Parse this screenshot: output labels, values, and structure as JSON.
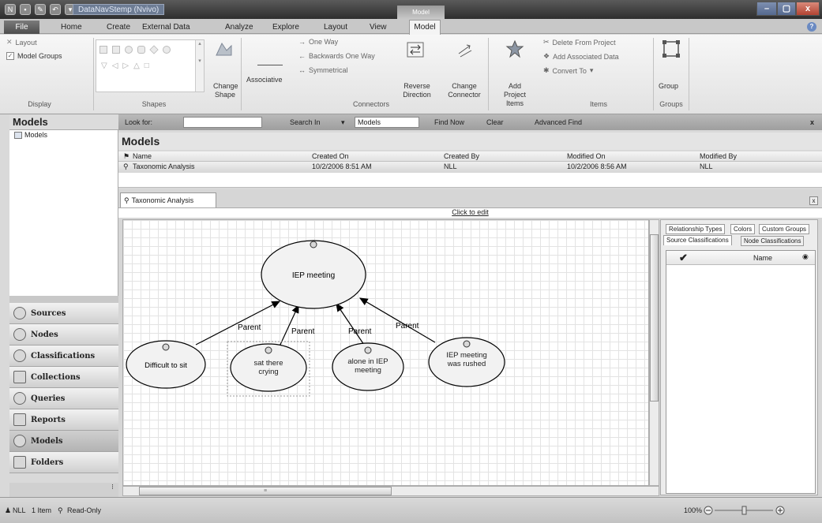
{
  "window": {
    "title": "DataNavStemp (Nvivo)",
    "context_tab_caption": "Model",
    "controls": [
      "–",
      "▢",
      "x"
    ]
  },
  "ribbon_tabs": [
    "File",
    "Home",
    "Create",
    "External Data",
    "Analyze",
    "Explore",
    "Layout",
    "View",
    "Model"
  ],
  "ribbon": {
    "display": {
      "layout": "Layout",
      "model_groups": "Model Groups",
      "group_label": "Display"
    },
    "shapes": {
      "change_shape": "Change Shape",
      "group_label": "Shapes"
    },
    "connectors": {
      "associative": "Associative",
      "one_way": "One Way",
      "backwards_one_way": "Backwards One Way",
      "symmetrical": "Symmetrical",
      "reverse_direction": "Reverse Direction",
      "change_connector": "Change Connector",
      "group_label": "Connectors"
    },
    "items": {
      "add_project_items": "Add Project Items",
      "delete_from_project": "Delete From Project",
      "add_associated_data": "Add Associated Data",
      "convert_to": "Convert To",
      "group_label": "Items"
    },
    "groups": {
      "group": "Group",
      "group_label": "Groups"
    }
  },
  "nav": {
    "header": "Models",
    "tree_item": "Models",
    "buttons": [
      "Sources",
      "Nodes",
      "Classifications",
      "Collections",
      "Queries",
      "Reports",
      "Models",
      "Folders"
    ],
    "active": "Models"
  },
  "findbar": {
    "look_for": "Look for:",
    "search_in": "Search In",
    "search_in_value": "Models",
    "find_now": "Find Now",
    "clear": "Clear",
    "advanced_find": "Advanced Find",
    "close": "x"
  },
  "list": {
    "title": "Models",
    "columns": [
      "Name",
      "Created On",
      "Created By",
      "Modified On",
      "Modified By"
    ],
    "rows": [
      {
        "name": "Taxonomic Analysis",
        "created_on": "10/2/2006 8:51 AM",
        "created_by": "NLL",
        "modified_on": "10/2/2006 8:56 AM",
        "modified_by": "NLL"
      }
    ]
  },
  "detail": {
    "tab": "Taxonomic Analysis",
    "click_to_edit": "Click to edit",
    "close": "x"
  },
  "model": {
    "center": "IEP meeting",
    "children": [
      "Difficult to sit",
      "sat there crying",
      "alone in IEP meeting",
      "IEP meeting was rushed"
    ],
    "edge_label": "Parent"
  },
  "right_panel": {
    "tabs_row1": [
      "Relationship Types",
      "Colors",
      "Custom Groups"
    ],
    "tabs_row2": [
      "Source Classifications",
      "Node Classifications"
    ],
    "grid_header": "Name"
  },
  "status": {
    "user": "NLL",
    "items": "1 Item",
    "mode": "Read-Only",
    "zoom": "100%"
  }
}
